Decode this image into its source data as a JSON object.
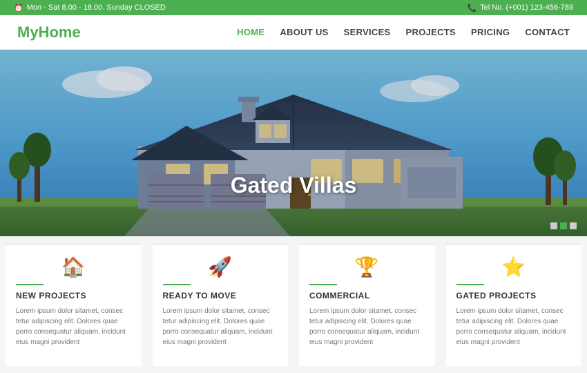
{
  "topbar": {
    "hours": "Mon - Sat 8.00 - 18.00. Sunday CLOSED",
    "phone": "Tel No. (+001) 123-456-789"
  },
  "logo": {
    "part1": "My",
    "part2": "Home"
  },
  "nav": {
    "items": [
      {
        "label": "HOME",
        "active": true
      },
      {
        "label": "ABOUT US",
        "active": false
      },
      {
        "label": "SERVICES",
        "active": false
      },
      {
        "label": "PROJECTS",
        "active": false
      },
      {
        "label": "PRICING",
        "active": false
      },
      {
        "label": "CONTACT",
        "active": false
      }
    ]
  },
  "hero": {
    "title": "Gated Villas"
  },
  "cards": [
    {
      "icon": "🏠",
      "title": "NEW PROJECTS",
      "text": "Lorem ipsum dolor sitamet, consec tetur adipiscing elit. Dolores quae porro consequatur aliquam, incidunt eius magni provident"
    },
    {
      "icon": "🚀",
      "title": "READY TO MOVE",
      "text": "Lorem ipsum dolor sitamet, consec tetur adipiscing elit. Dolores quae porro consequatur aliquam, incidunt eius magni provident"
    },
    {
      "icon": "🏆",
      "title": "COMMERCIAL",
      "text": "Lorem ipsum dolor sitamet, consec tetur adipiscing elit. Dolores quae porro consequatur aliquam, incidunt eius magni provident"
    },
    {
      "icon": "⭐",
      "title": "GATED PROJECTS",
      "text": "Lorem ipsum dolor sitamet, consec tetur adipiscing elit. Dolores quae porro consequatur aliquam, incidunt eius magni provident"
    }
  ],
  "colors": {
    "green": "#4CAF50",
    "dark": "#222222",
    "light_gray": "#f5f5f5"
  }
}
